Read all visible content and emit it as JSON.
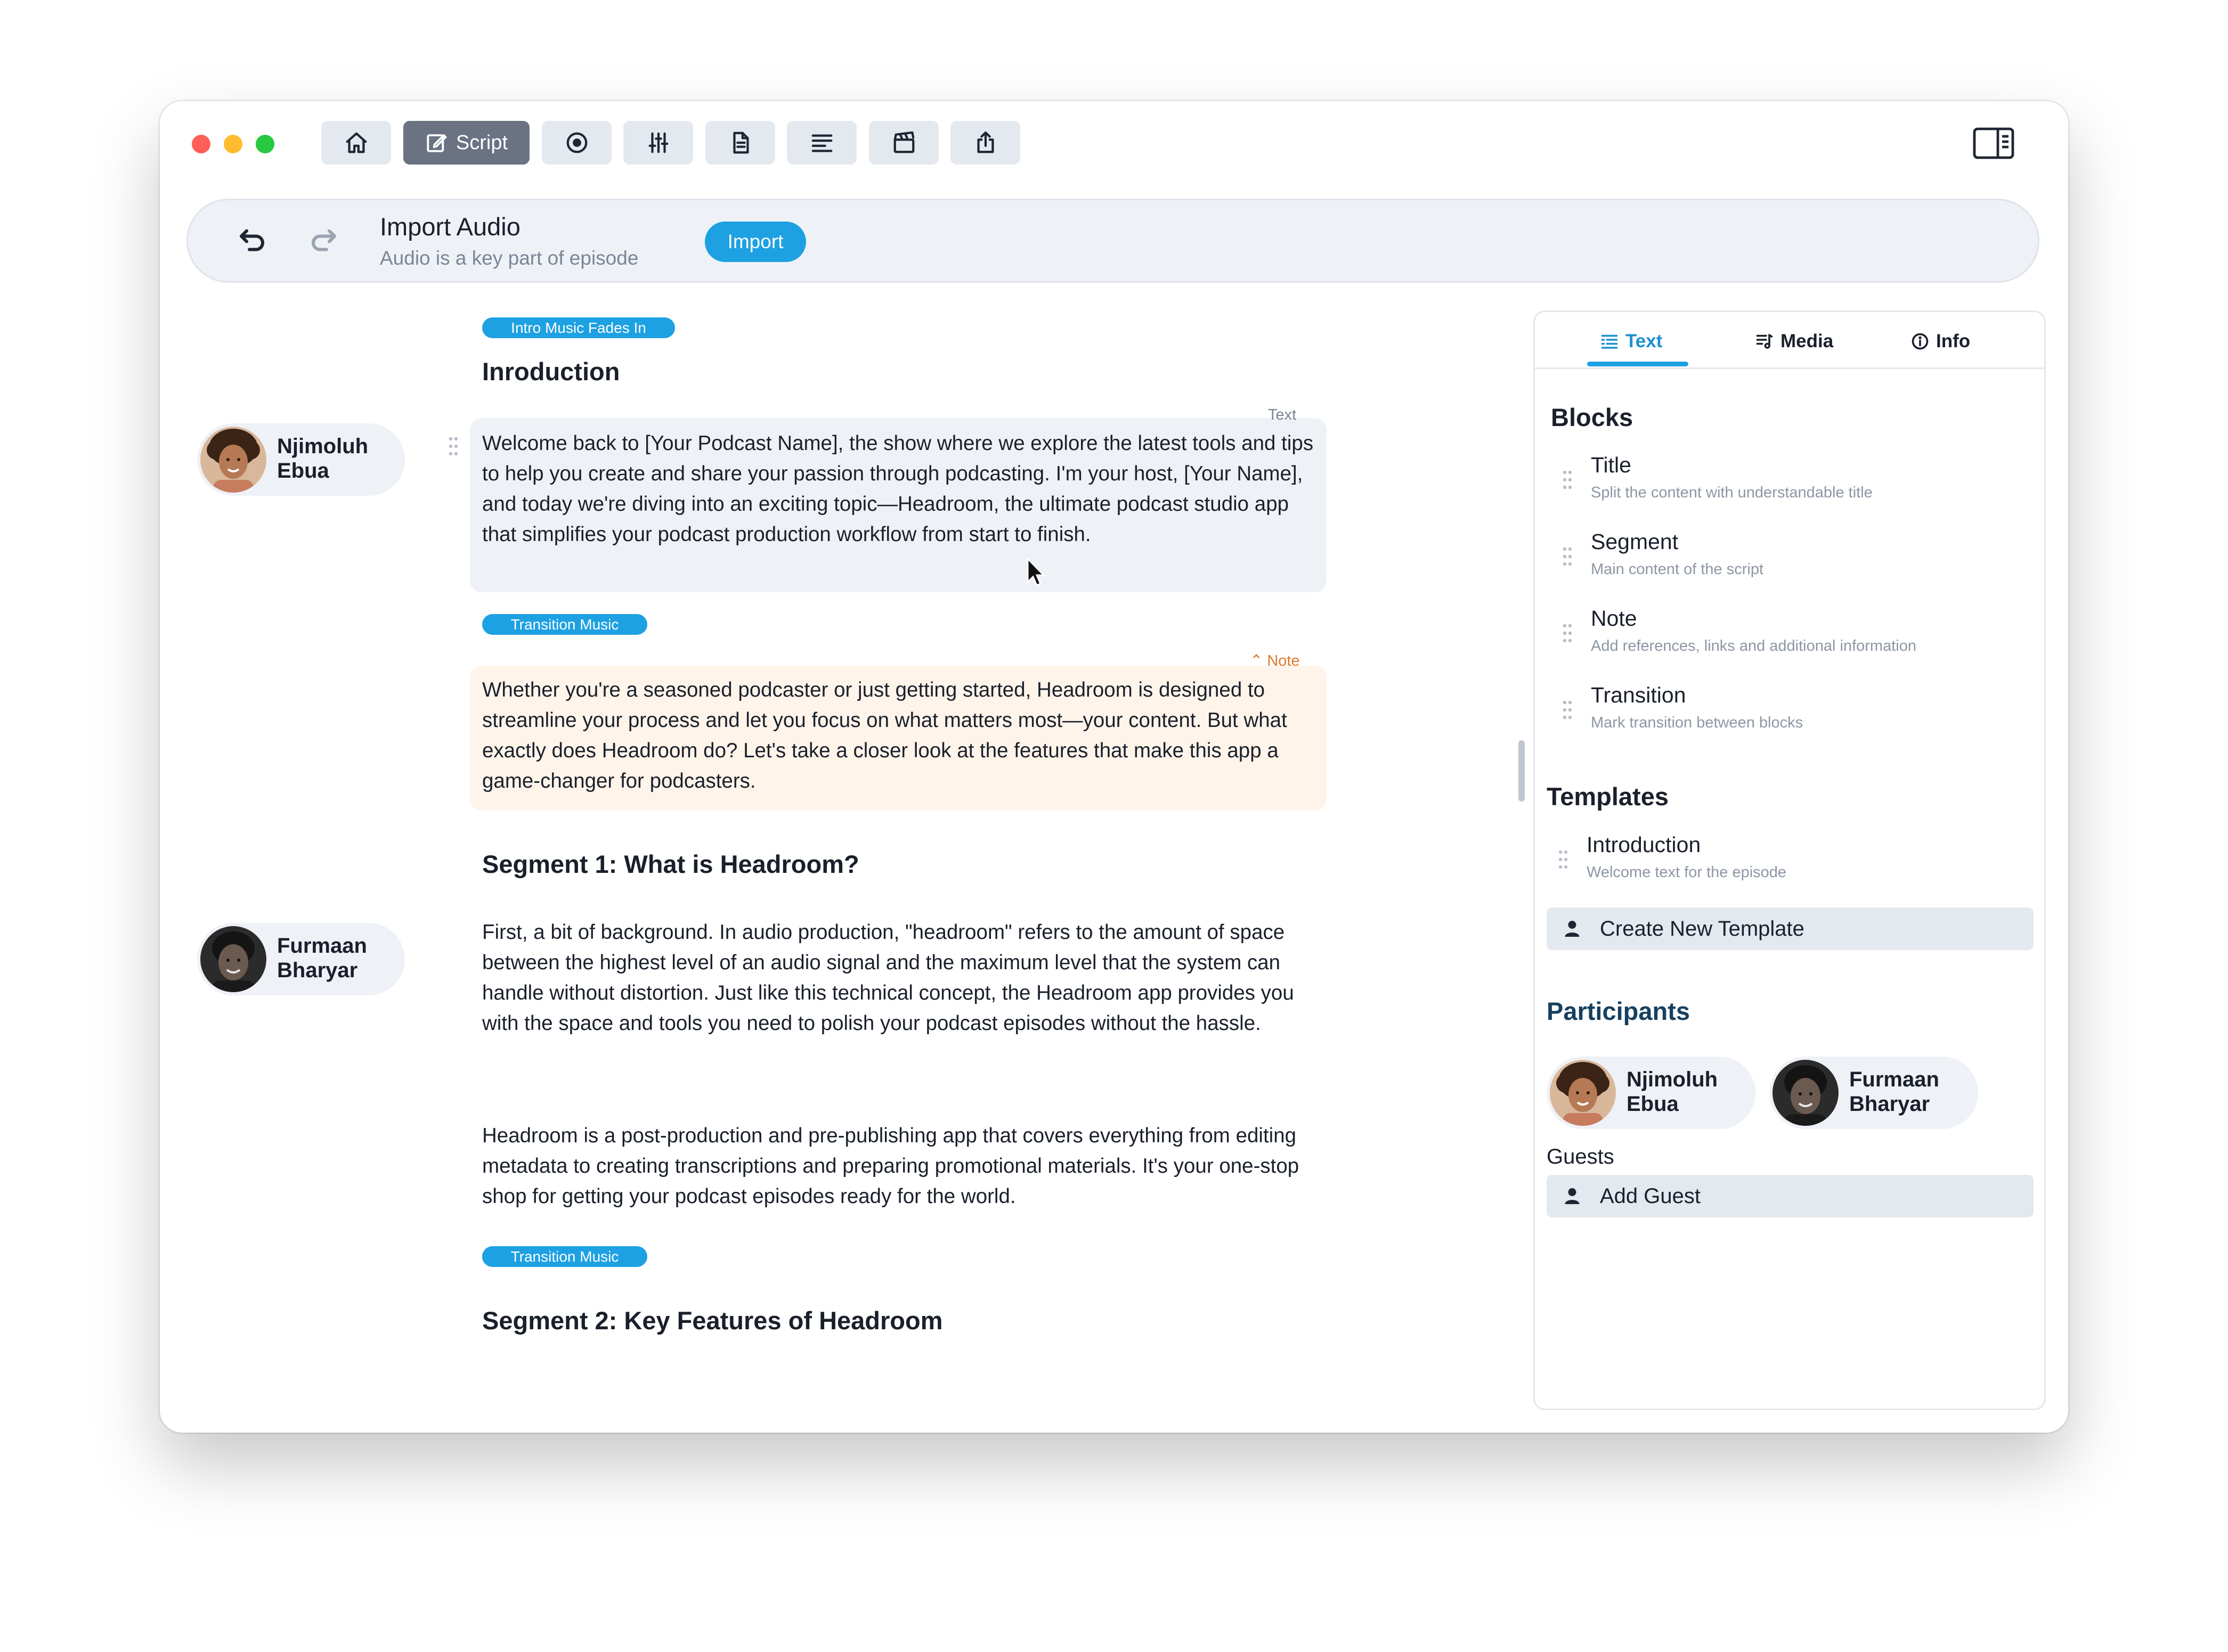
{
  "toolbar": {
    "script_label": "Script",
    "buttons": [
      "home-icon",
      "edit-icon",
      "record-icon",
      "mixer-icon",
      "document-icon",
      "list-icon",
      "clapper-icon",
      "share-icon"
    ]
  },
  "banner": {
    "title": "Import Audio",
    "subtitle": "Audio is a key part of episode",
    "import_label": "Import"
  },
  "script": {
    "tag_intro": "Intro Music Fades In",
    "heading_intro": "Inroduction",
    "block1_label": "Text",
    "block1_text": "Welcome back to [Your Podcast Name], the show where we explore the latest tools and tips to help you create and share your passion through podcasting. I'm your host, [Your Name], and today we're diving into an exciting topic—Headroom, the ultimate podcast studio app that simplifies your podcast production workflow from start to finish.",
    "tag_transition1": "Transition Music",
    "note_label": "Note",
    "note_text": "Whether you're a seasoned podcaster or just getting started, Headroom is designed to streamline your process and let you focus on what matters most—your content. But what exactly does Headroom do? Let's take a closer look at the features that make this app a game-changer for podcasters.",
    "heading_seg1": "Segment 1: What is Headroom?",
    "seg1_text1": "First, a bit of background. In audio production, \"headroom\" refers to the amount of space between the highest level of an audio signal and the maximum level that the system can handle without distortion. Just like this technical concept, the Headroom app provides you with the space and tools you need to polish your podcast episodes without the hassle.",
    "seg1_text2": "Headroom is a post-production and pre-publishing app that covers everything from editing metadata to creating transcriptions and preparing promotional materials. It's your one-stop shop for getting your podcast episodes ready for the world.",
    "tag_transition2": "Transition Music",
    "heading_seg2": "Segment 2: Key Features of Headroom"
  },
  "speakers": [
    {
      "name_line1": "Njimoluh",
      "name_line2": "Ebua"
    },
    {
      "name_line1": "Furmaan",
      "name_line2": "Bharyar"
    }
  ],
  "panel": {
    "tabs": [
      {
        "label": "Text"
      },
      {
        "label": "Media"
      },
      {
        "label": "Info"
      }
    ],
    "blocks_title": "Blocks",
    "blocks": [
      {
        "name": "Title",
        "desc": "Split the content with understandable title"
      },
      {
        "name": "Segment",
        "desc": "Main content of the script"
      },
      {
        "name": "Note",
        "desc": "Add references, links and additional information"
      },
      {
        "name": "Transition",
        "desc": "Mark transition between blocks"
      }
    ],
    "templates_title": "Templates",
    "template": {
      "name": "Introduction",
      "desc": "Welcome text for the episode"
    },
    "create_template_label": "Create New Template",
    "participants_title": "Participants",
    "participants": [
      {
        "name_line1": "Njimoluh",
        "name_line2": "Ebua"
      },
      {
        "name_line1": "Furmaan",
        "name_line2": "Bharyar"
      }
    ],
    "guests_title": "Guests",
    "add_guest_label": "Add Guest"
  }
}
